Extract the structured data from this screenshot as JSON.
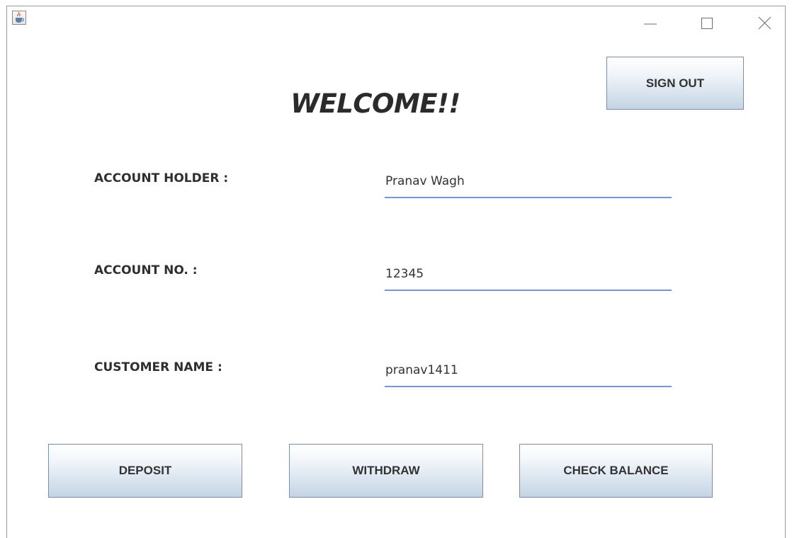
{
  "window": {
    "title": ""
  },
  "header": {
    "title": "WELCOME!!",
    "sign_out_label": "SIGN OUT"
  },
  "fields": [
    {
      "label": "ACCOUNT HOLDER :",
      "value": "Pranav Wagh"
    },
    {
      "label": "ACCOUNT NO. :",
      "value": "12345"
    },
    {
      "label": "CUSTOMER NAME :",
      "value": "pranav1411"
    }
  ],
  "actions": {
    "deposit_label": "DEPOSIT",
    "withdraw_label": "WITHDRAW",
    "check_balance_label": "CHECK BALANCE"
  },
  "icons": {
    "app": "java-cup-icon",
    "minimize": "minimize-icon",
    "maximize": "maximize-icon",
    "close": "close-icon"
  },
  "colors": {
    "field_underline": "#7a93d4",
    "button_border": "#7b8fa8",
    "button_gradient_bottom": "#c4d3e3",
    "text": "#333333"
  }
}
